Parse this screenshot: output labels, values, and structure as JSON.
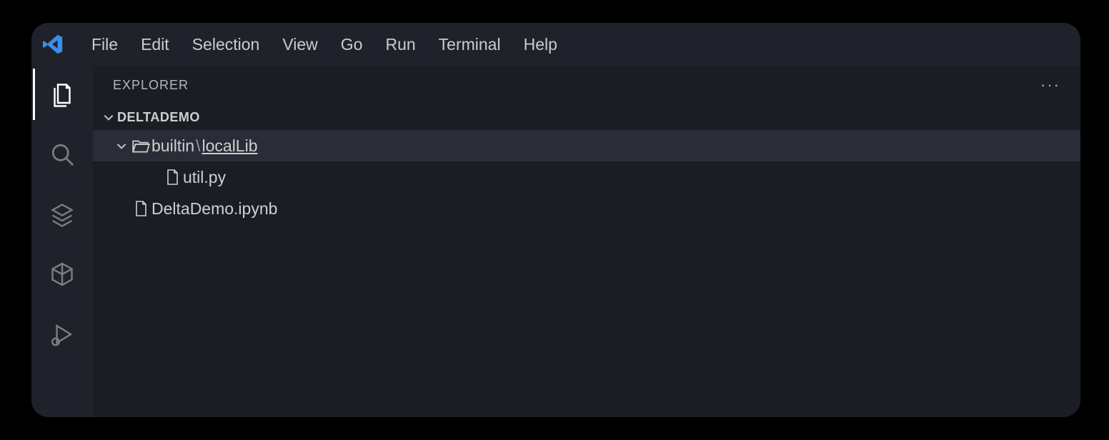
{
  "menubar": {
    "items": [
      "File",
      "Edit",
      "Selection",
      "View",
      "Go",
      "Run",
      "Terminal",
      "Help"
    ]
  },
  "explorer": {
    "title": "EXPLORER",
    "more": "···",
    "workspace": "DELTADEMO",
    "tree": {
      "folder_prefix": "builtin",
      "folder_sep": "\\",
      "folder_name": "localLib",
      "file1": "util.py",
      "file2": "DeltaDemo.ipynb"
    }
  }
}
